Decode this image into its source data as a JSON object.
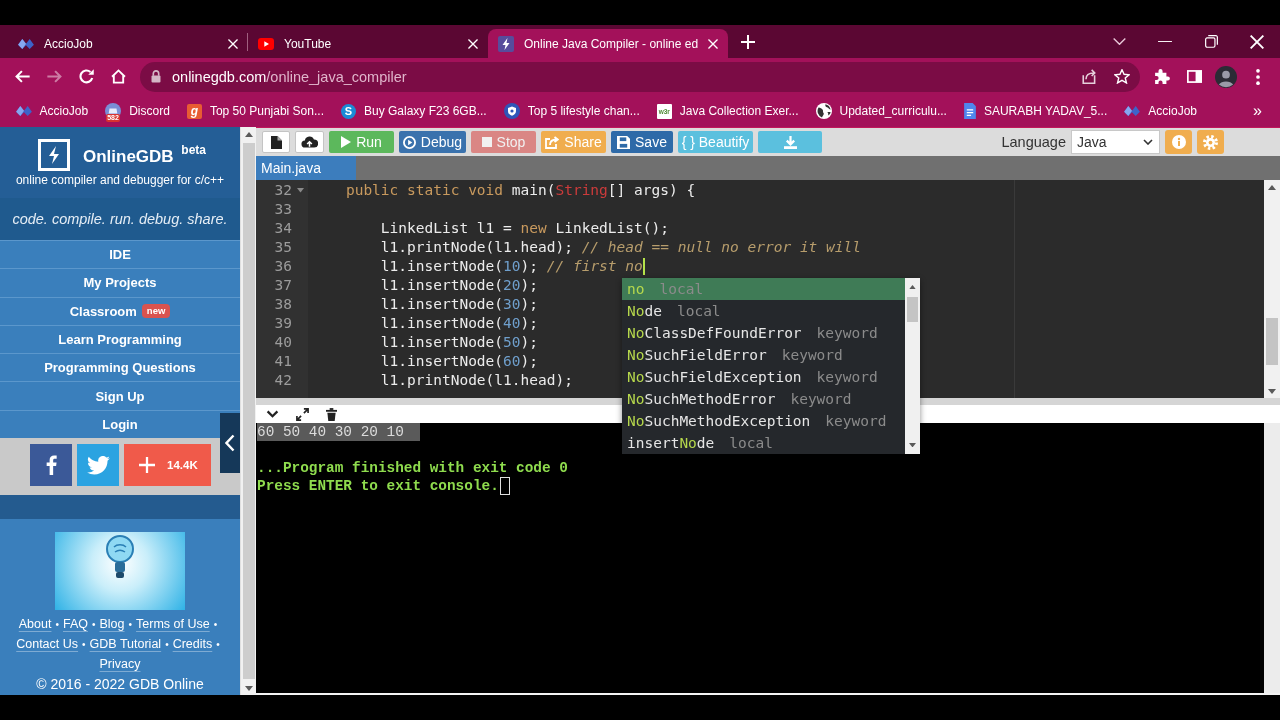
{
  "browser": {
    "tabs": [
      {
        "title": "AccioJob",
        "selected": false
      },
      {
        "title": "YouTube",
        "selected": false
      },
      {
        "title": "Online Java Compiler - online ed",
        "selected": true
      }
    ],
    "forward_disabled": true,
    "url": {
      "host": "onlinegdb.com",
      "path": "/online_java_compiler"
    },
    "bookmarks": [
      {
        "label": "AccioJob"
      },
      {
        "label": "Discord",
        "badge": "582"
      },
      {
        "label": "Top 50 Punjabi Son...",
        "icon_letter": "g"
      },
      {
        "label": "Buy Galaxy F23 6GB...",
        "icon_letter": "S"
      },
      {
        "label": "Top 5 lifestyle chan..."
      },
      {
        "label": "Java Collection Exer...",
        "icon_letter": "w3r"
      },
      {
        "label": "Updated_curriculu..."
      },
      {
        "label": "SAURABH YADAV_5..."
      },
      {
        "label": "AccioJob"
      }
    ],
    "bookmarks_more": "»"
  },
  "sidebar": {
    "title": "OnlineGDB $^{beta}$",
    "subtitle": "online compiler and debugger for c/c++",
    "tagline": "code. compile. run. debug. share.",
    "menu": [
      {
        "label": "IDE"
      },
      {
        "label": "My Projects"
      },
      {
        "label": "Classroom",
        "badge": "new"
      },
      {
        "label": "Learn Programming"
      },
      {
        "label": "Programming Questions"
      },
      {
        "label": "Sign Up"
      },
      {
        "label": "Login"
      }
    ],
    "social": [
      {
        "kind": "facebook"
      },
      {
        "kind": "twitter"
      },
      {
        "kind": "share",
        "count": "14.4K"
      }
    ],
    "footer_rows": [
      {
        "links": [
          {
            "text": "About",
            "separator": "•"
          },
          {
            "text": "FAQ",
            "separator": "•"
          },
          {
            "text": "Blog",
            "separator": "•"
          },
          {
            "text": "Terms of Use",
            "separator": "•"
          }
        ]
      },
      {
        "links": [
          {
            "text": "Contact Us",
            "separator": "•"
          },
          {
            "text": "GDB Tutorial",
            "separator": "•"
          },
          {
            "text": "Credits",
            "separator": "•"
          }
        ]
      },
      {
        "links": [
          {
            "text": "Privacy"
          }
        ]
      }
    ],
    "copyright": "© 2016 - 2022 GDB Online"
  },
  "toolbar": {
    "buttons": [
      {
        "kind": "new-file",
        "disabled": false
      },
      {
        "kind": "upload",
        "disabled": false
      },
      {
        "kind": "run",
        "label": "Run",
        "disabled": false
      },
      {
        "kind": "debug",
        "label": "Debug",
        "disabled": false
      },
      {
        "kind": "stop",
        "label": "Stop",
        "disabled": true
      },
      {
        "kind": "share",
        "label": "Share",
        "disabled": false
      },
      {
        "kind": "save",
        "label": "Save",
        "disabled": false
      },
      {
        "kind": "beautify",
        "label": "{ } Beautify",
        "disabled": false
      },
      {
        "kind": "download",
        "disabled": false
      }
    ],
    "language_label": "Language",
    "language": "Java"
  },
  "file_tabs": [
    {
      "label": "Main.java",
      "selected": true
    }
  ],
  "editor": {
    "lines": [
      {
        "number": "32",
        "foldable": true,
        "cursor": false,
        "tokens": [
          {
            "text": "    public static void",
            "kind": "keyword"
          },
          {
            "text": " main(",
            "kind": "plain"
          },
          {
            "text": "String",
            "kind": "type"
          },
          {
            "text": "[] args) {",
            "kind": "plain"
          }
        ]
      },
      {
        "number": "33",
        "foldable": false,
        "cursor": false
      },
      {
        "number": "34",
        "foldable": false,
        "cursor": false,
        "tokens": [
          {
            "text": "        LinkedList l1 = ",
            "kind": "plain"
          },
          {
            "text": "new",
            "kind": "keyword"
          },
          {
            "text": " LinkedList();",
            "kind": "plain"
          }
        ]
      },
      {
        "number": "35",
        "foldable": false,
        "cursor": false,
        "tokens": [
          {
            "text": "        l1.printNode(l1.head); ",
            "kind": "plain"
          },
          {
            "text": "// head == null no error it will",
            "kind": "comment"
          }
        ]
      },
      {
        "number": "36",
        "foldable": false,
        "cursor": true,
        "tokens": [
          {
            "text": "        l1.insertNode(",
            "kind": "plain"
          },
          {
            "text": "10",
            "kind": "number"
          },
          {
            "text": "); ",
            "kind": "plain"
          },
          {
            "text": "// first no",
            "kind": "comment"
          }
        ]
      },
      {
        "number": "37",
        "foldable": false,
        "cursor": false,
        "tokens": [
          {
            "text": "        l1.insertNode(",
            "kind": "plain"
          },
          {
            "text": "20",
            "kind": "number"
          },
          {
            "text": ");",
            "kind": "plain"
          }
        ]
      },
      {
        "number": "38",
        "foldable": false,
        "cursor": false,
        "tokens": [
          {
            "text": "        l1.insertNode(",
            "kind": "plain"
          },
          {
            "text": "30",
            "kind": "number"
          },
          {
            "text": ");",
            "kind": "plain"
          }
        ]
      },
      {
        "number": "39",
        "foldable": false,
        "cursor": false,
        "tokens": [
          {
            "text": "        l1.insertNode(",
            "kind": "plain"
          },
          {
            "text": "40",
            "kind": "number"
          },
          {
            "text": ");",
            "kind": "plain"
          }
        ]
      },
      {
        "number": "40",
        "foldable": false,
        "cursor": false,
        "tokens": [
          {
            "text": "        l1.insertNode(",
            "kind": "plain"
          },
          {
            "text": "50",
            "kind": "number"
          },
          {
            "text": ");",
            "kind": "plain"
          }
        ]
      },
      {
        "number": "41",
        "foldable": false,
        "cursor": false,
        "tokens": [
          {
            "text": "        l1.insertNode(",
            "kind": "plain"
          },
          {
            "text": "60",
            "kind": "number"
          },
          {
            "text": ");",
            "kind": "plain"
          }
        ]
      },
      {
        "number": "42",
        "foldable": false,
        "cursor": false,
        "tokens": [
          {
            "text": "        l1.printNode(l1.head);",
            "kind": "plain"
          }
        ]
      }
    ]
  },
  "autocomplete": {
    "items": [
      {
        "match": "no",
        "meta": "local",
        "selected": true
      },
      {
        "match": "No",
        "after": "de",
        "meta": "local",
        "selected": false
      },
      {
        "match": "No",
        "after": "ClassDefFoundError",
        "meta": "keyword",
        "selected": false
      },
      {
        "match": "No",
        "after": "SuchFieldError",
        "meta": "keyword",
        "selected": false
      },
      {
        "match": "No",
        "after": "SuchFieldException",
        "meta": "keyword",
        "selected": false
      },
      {
        "match": "No",
        "after": "SuchMethodError",
        "meta": "keyword",
        "selected": false
      },
      {
        "match": "No",
        "after": "SuchMethodException",
        "meta": "keyword",
        "selected": false
      },
      {
        "before": "insert",
        "match": "No",
        "after": "de",
        "meta": "local",
        "selected": false
      }
    ]
  },
  "console": {
    "lines": [
      {
        "kind": "output",
        "text": "60 50 40 30 20 10",
        "highlighted": true,
        "cursor": false
      },
      {
        "kind": "blank"
      },
      {
        "kind": "status",
        "text": "...Program finished with exit code 0",
        "highlighted": false,
        "cursor": false
      },
      {
        "kind": "status",
        "text": "Press ENTER to exit console.",
        "highlighted": false,
        "cursor": true
      }
    ]
  }
}
